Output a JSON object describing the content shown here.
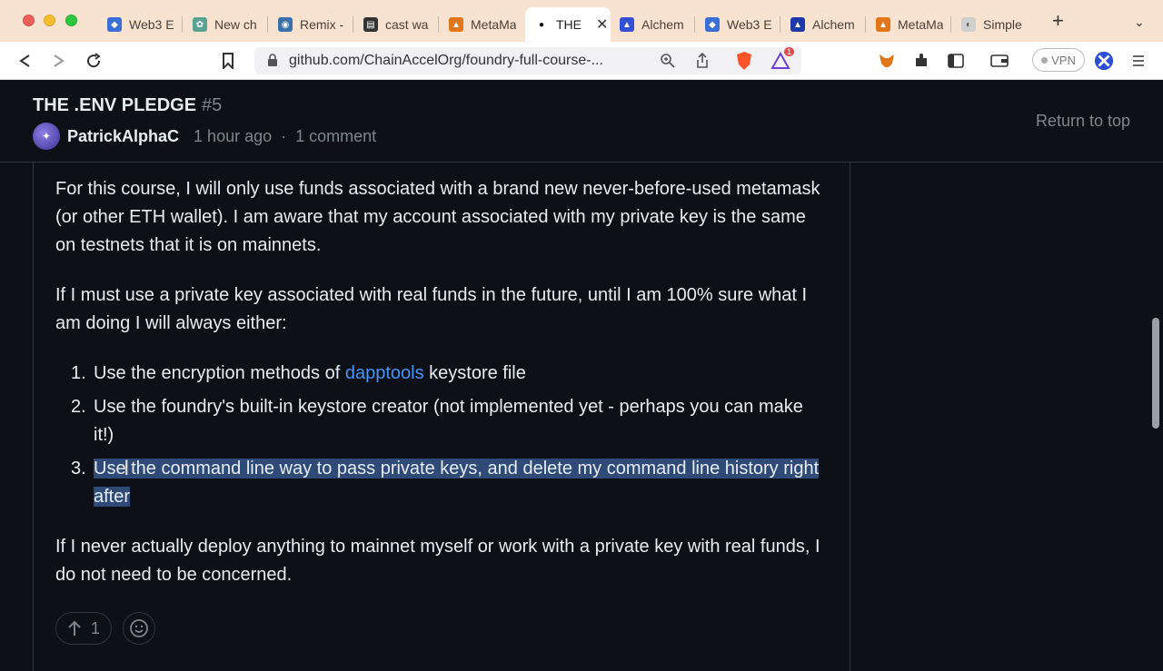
{
  "browser": {
    "tabs": [
      {
        "title": "Web3 E",
        "icon": "web3-icon",
        "color": "#3b6fd8"
      },
      {
        "title": "New ch",
        "icon": "chatgpt-icon",
        "color": "#5aa392"
      },
      {
        "title": "Remix -",
        "icon": "remix-icon",
        "color": "#3a6fa8"
      },
      {
        "title": "cast wa",
        "icon": "docs-icon",
        "color": "#333333"
      },
      {
        "title": "MetaMa",
        "icon": "metamask-icon",
        "color": "#e2761b"
      },
      {
        "title": "THE",
        "icon": "github-icon",
        "color": "#ffffff",
        "active": true
      },
      {
        "title": "Alchem",
        "icon": "alchemy-icon",
        "color": "#3450d6"
      },
      {
        "title": "Web3 E",
        "icon": "web3-icon",
        "color": "#3b6fd8"
      },
      {
        "title": "Alchem",
        "icon": "alchemy-icon",
        "color": "#1e3aa8"
      },
      {
        "title": "MetaMa",
        "icon": "metamask-icon",
        "color": "#e2761b"
      },
      {
        "title": "Simple",
        "icon": "simple-icon",
        "color": "#cfcfcf"
      }
    ],
    "url": "github.com/ChainAccelOrg/foundry-full-course-...",
    "vpn_label": "VPN",
    "brave_badge": "1"
  },
  "issue": {
    "title": "THE .ENV PLEDGE",
    "number": "#5",
    "author": "PatrickAlphaC",
    "time": "1 hour ago",
    "separator": "·",
    "comments": "1 comment",
    "return_top": "Return to top"
  },
  "body": {
    "p1": "For this course, I will only use funds associated with a brand new never-before-used metamask (or other ETH wallet). I am aware that my account associated with my private key is the same on testnets that it is on mainnets.",
    "p2": "If I must use a private key associated with real funds in the future, until I am 100% sure what I am doing I will always either:",
    "list": [
      {
        "num": "1.",
        "before": "Use the encryption methods of ",
        "link": "dapptools",
        "after": " keystore file"
      },
      {
        "num": "2.",
        "text": "Use the foundry's built-in keystore creator (not implemented yet - perhaps you can make it!)"
      },
      {
        "num": "3.",
        "text": "Use the command line way to pass private keys, and delete my command line history right after"
      }
    ],
    "p3": "If I never actually deploy anything to mainnet myself or work with a private key with real funds, I do not need to be concerned."
  },
  "reactions": {
    "upvote_count": "1"
  },
  "colors": {
    "accent_link": "#4493f8",
    "selection": "#2f4a76",
    "background": "#0d1117"
  }
}
